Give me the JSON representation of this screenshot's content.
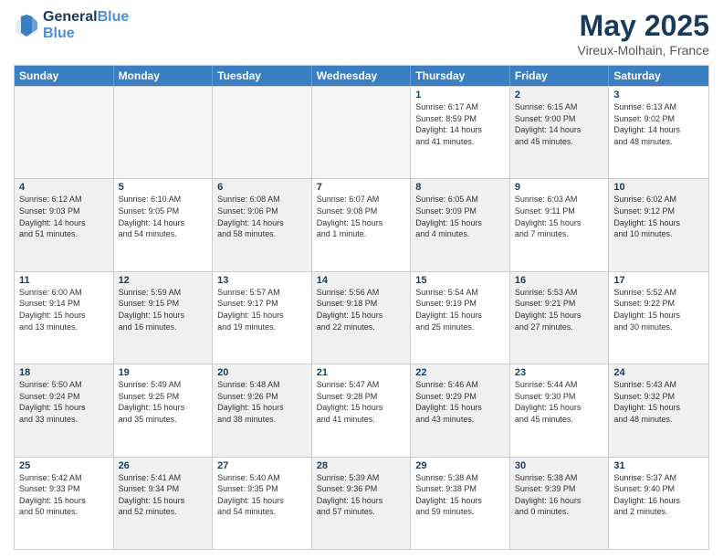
{
  "header": {
    "logo_line1": "General",
    "logo_line2": "Blue",
    "month": "May 2025",
    "location": "Vireux-Molhain, France"
  },
  "days_of_week": [
    "Sunday",
    "Monday",
    "Tuesday",
    "Wednesday",
    "Thursday",
    "Friday",
    "Saturday"
  ],
  "weeks": [
    [
      {
        "day": "",
        "text": "",
        "empty": true
      },
      {
        "day": "",
        "text": "",
        "empty": true
      },
      {
        "day": "",
        "text": "",
        "empty": true
      },
      {
        "day": "",
        "text": "",
        "empty": true
      },
      {
        "day": "1",
        "text": "Sunrise: 6:17 AM\nSunset: 8:59 PM\nDaylight: 14 hours\nand 41 minutes.",
        "shaded": false
      },
      {
        "day": "2",
        "text": "Sunrise: 6:15 AM\nSunset: 9:00 PM\nDaylight: 14 hours\nand 45 minutes.",
        "shaded": true
      },
      {
        "day": "3",
        "text": "Sunrise: 6:13 AM\nSunset: 9:02 PM\nDaylight: 14 hours\nand 48 minutes.",
        "shaded": false
      }
    ],
    [
      {
        "day": "4",
        "text": "Sunrise: 6:12 AM\nSunset: 9:03 PM\nDaylight: 14 hours\nand 51 minutes.",
        "shaded": true
      },
      {
        "day": "5",
        "text": "Sunrise: 6:10 AM\nSunset: 9:05 PM\nDaylight: 14 hours\nand 54 minutes.",
        "shaded": false
      },
      {
        "day": "6",
        "text": "Sunrise: 6:08 AM\nSunset: 9:06 PM\nDaylight: 14 hours\nand 58 minutes.",
        "shaded": true
      },
      {
        "day": "7",
        "text": "Sunrise: 6:07 AM\nSunset: 9:08 PM\nDaylight: 15 hours\nand 1 minute.",
        "shaded": false
      },
      {
        "day": "8",
        "text": "Sunrise: 6:05 AM\nSunset: 9:09 PM\nDaylight: 15 hours\nand 4 minutes.",
        "shaded": true
      },
      {
        "day": "9",
        "text": "Sunrise: 6:03 AM\nSunset: 9:11 PM\nDaylight: 15 hours\nand 7 minutes.",
        "shaded": false
      },
      {
        "day": "10",
        "text": "Sunrise: 6:02 AM\nSunset: 9:12 PM\nDaylight: 15 hours\nand 10 minutes.",
        "shaded": true
      }
    ],
    [
      {
        "day": "11",
        "text": "Sunrise: 6:00 AM\nSunset: 9:14 PM\nDaylight: 15 hours\nand 13 minutes.",
        "shaded": false
      },
      {
        "day": "12",
        "text": "Sunrise: 5:59 AM\nSunset: 9:15 PM\nDaylight: 15 hours\nand 16 minutes.",
        "shaded": true
      },
      {
        "day": "13",
        "text": "Sunrise: 5:57 AM\nSunset: 9:17 PM\nDaylight: 15 hours\nand 19 minutes.",
        "shaded": false
      },
      {
        "day": "14",
        "text": "Sunrise: 5:56 AM\nSunset: 9:18 PM\nDaylight: 15 hours\nand 22 minutes.",
        "shaded": true
      },
      {
        "day": "15",
        "text": "Sunrise: 5:54 AM\nSunset: 9:19 PM\nDaylight: 15 hours\nand 25 minutes.",
        "shaded": false
      },
      {
        "day": "16",
        "text": "Sunrise: 5:53 AM\nSunset: 9:21 PM\nDaylight: 15 hours\nand 27 minutes.",
        "shaded": true
      },
      {
        "day": "17",
        "text": "Sunrise: 5:52 AM\nSunset: 9:22 PM\nDaylight: 15 hours\nand 30 minutes.",
        "shaded": false
      }
    ],
    [
      {
        "day": "18",
        "text": "Sunrise: 5:50 AM\nSunset: 9:24 PM\nDaylight: 15 hours\nand 33 minutes.",
        "shaded": true
      },
      {
        "day": "19",
        "text": "Sunrise: 5:49 AM\nSunset: 9:25 PM\nDaylight: 15 hours\nand 35 minutes.",
        "shaded": false
      },
      {
        "day": "20",
        "text": "Sunrise: 5:48 AM\nSunset: 9:26 PM\nDaylight: 15 hours\nand 38 minutes.",
        "shaded": true
      },
      {
        "day": "21",
        "text": "Sunrise: 5:47 AM\nSunset: 9:28 PM\nDaylight: 15 hours\nand 41 minutes.",
        "shaded": false
      },
      {
        "day": "22",
        "text": "Sunrise: 5:46 AM\nSunset: 9:29 PM\nDaylight: 15 hours\nand 43 minutes.",
        "shaded": true
      },
      {
        "day": "23",
        "text": "Sunrise: 5:44 AM\nSunset: 9:30 PM\nDaylight: 15 hours\nand 45 minutes.",
        "shaded": false
      },
      {
        "day": "24",
        "text": "Sunrise: 5:43 AM\nSunset: 9:32 PM\nDaylight: 15 hours\nand 48 minutes.",
        "shaded": true
      }
    ],
    [
      {
        "day": "25",
        "text": "Sunrise: 5:42 AM\nSunset: 9:33 PM\nDaylight: 15 hours\nand 50 minutes.",
        "shaded": false
      },
      {
        "day": "26",
        "text": "Sunrise: 5:41 AM\nSunset: 9:34 PM\nDaylight: 15 hours\nand 52 minutes.",
        "shaded": true
      },
      {
        "day": "27",
        "text": "Sunrise: 5:40 AM\nSunset: 9:35 PM\nDaylight: 15 hours\nand 54 minutes.",
        "shaded": false
      },
      {
        "day": "28",
        "text": "Sunrise: 5:39 AM\nSunset: 9:36 PM\nDaylight: 15 hours\nand 57 minutes.",
        "shaded": true
      },
      {
        "day": "29",
        "text": "Sunrise: 5:38 AM\nSunset: 9:38 PM\nDaylight: 15 hours\nand 59 minutes.",
        "shaded": false
      },
      {
        "day": "30",
        "text": "Sunrise: 5:38 AM\nSunset: 9:39 PM\nDaylight: 16 hours\nand 0 minutes.",
        "shaded": true
      },
      {
        "day": "31",
        "text": "Sunrise: 5:37 AM\nSunset: 9:40 PM\nDaylight: 16 hours\nand 2 minutes.",
        "shaded": false
      }
    ]
  ]
}
